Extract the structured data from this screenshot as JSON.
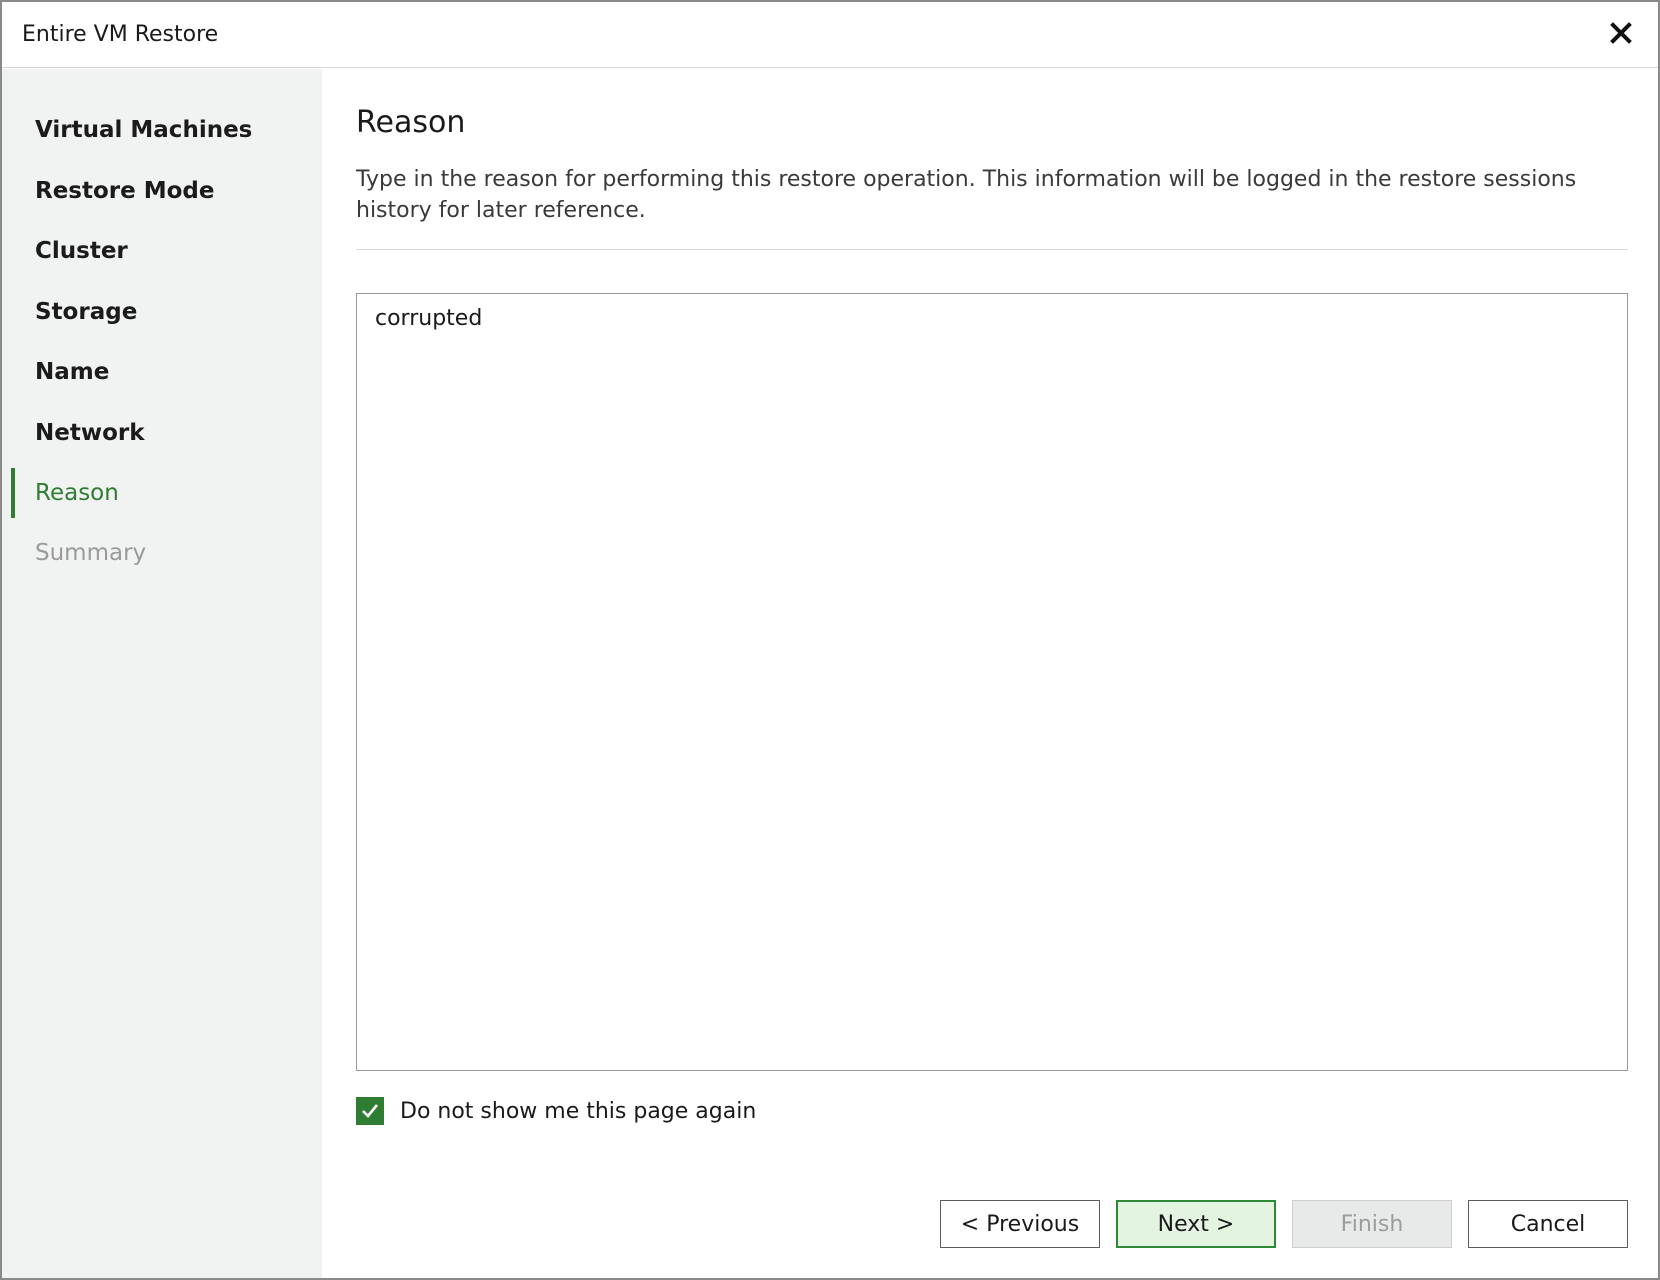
{
  "window": {
    "title": "Entire VM Restore",
    "close_icon": "close-icon"
  },
  "sidebar": {
    "items": [
      {
        "label": "Virtual Machines",
        "state": "completed"
      },
      {
        "label": "Restore Mode",
        "state": "completed"
      },
      {
        "label": "Cluster",
        "state": "completed"
      },
      {
        "label": "Storage",
        "state": "completed"
      },
      {
        "label": "Name",
        "state": "completed"
      },
      {
        "label": "Network",
        "state": "completed"
      },
      {
        "label": "Reason",
        "state": "active"
      },
      {
        "label": "Summary",
        "state": "disabled"
      }
    ]
  },
  "page": {
    "heading": "Reason",
    "description": "Type in the reason for performing this restore operation. This information will be logged in the restore sessions history for later reference.",
    "reason_value": "corrupted",
    "checkbox_label": "Do not show me this page again",
    "checkbox_checked": true
  },
  "buttons": {
    "previous": "< Previous",
    "next": "Next >",
    "finish": "Finish",
    "cancel": "Cancel"
  },
  "colors": {
    "accent": "#2f7d32",
    "primary_button_bg": "#e3f5e1",
    "sidebar_bg": "#f1f2f2"
  }
}
